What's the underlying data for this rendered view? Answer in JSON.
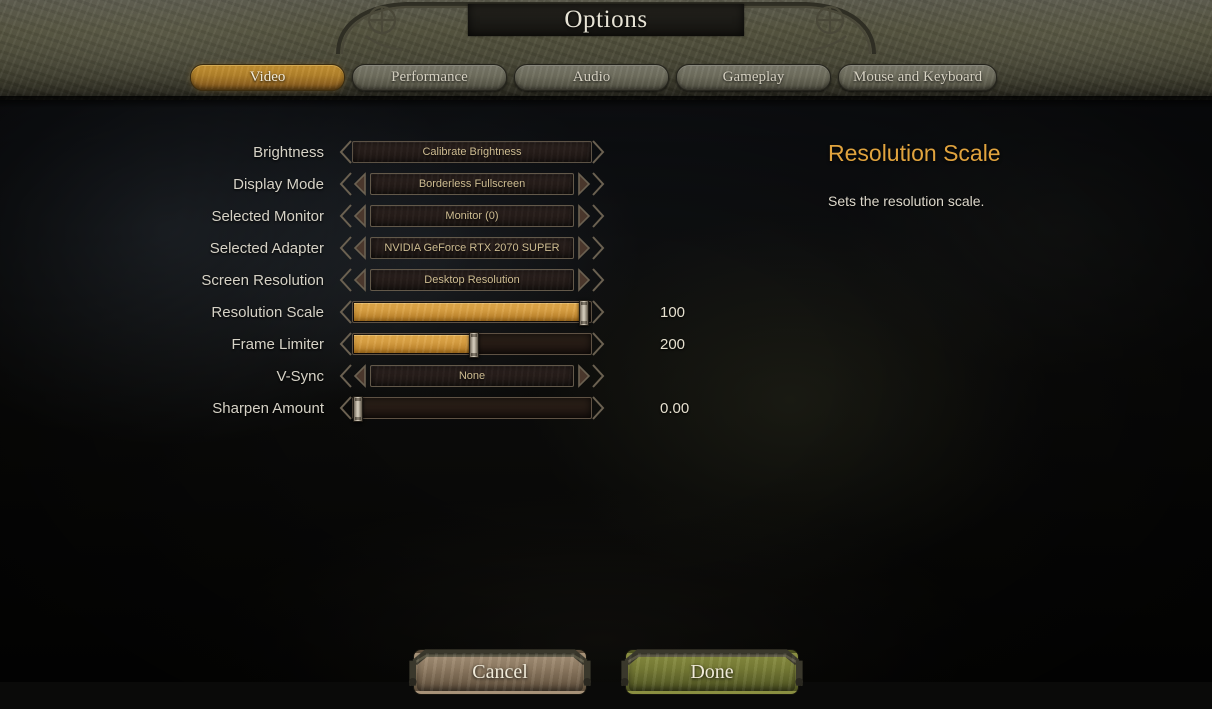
{
  "header": {
    "title": "Options"
  },
  "tabs": [
    {
      "label": "Video",
      "active": true
    },
    {
      "label": "Performance",
      "active": false
    },
    {
      "label": "Audio",
      "active": false
    },
    {
      "label": "Gameplay",
      "active": false
    },
    {
      "label": "Mouse and Keyboard",
      "active": false
    }
  ],
  "settings": [
    {
      "label": "Brightness",
      "type": "button",
      "value": "Calibrate Brightness"
    },
    {
      "label": "Display Mode",
      "type": "dropdown",
      "value": "Borderless Fullscreen"
    },
    {
      "label": "Selected Monitor",
      "type": "dropdown",
      "value": "Monitor (0)"
    },
    {
      "label": "Selected Adapter",
      "type": "dropdown",
      "value": "NVIDIA GeForce RTX 2070 SUPER"
    },
    {
      "label": "Screen Resolution",
      "type": "dropdown",
      "value": "Desktop Resolution"
    },
    {
      "label": "Resolution Scale",
      "type": "slider",
      "value": "100",
      "percent": 97
    },
    {
      "label": "Frame Limiter",
      "type": "slider",
      "value": "200",
      "percent": 51
    },
    {
      "label": "V-Sync",
      "type": "dropdown",
      "value": "None"
    },
    {
      "label": "Sharpen Amount",
      "type": "slider",
      "value": "0.00",
      "percent": 2
    }
  ],
  "info": {
    "title": "Resolution Scale",
    "description": "Sets the resolution scale."
  },
  "footer": {
    "cancel_label": "Cancel",
    "done_label": "Done"
  },
  "colors": {
    "accent_gold": "#e0a33e",
    "slider_fill": "#d9a043",
    "tab_active": "#b2812a",
    "done_green": "#787d36",
    "cancel_tan": "#917d64",
    "label_text": "#d6d2c6"
  }
}
